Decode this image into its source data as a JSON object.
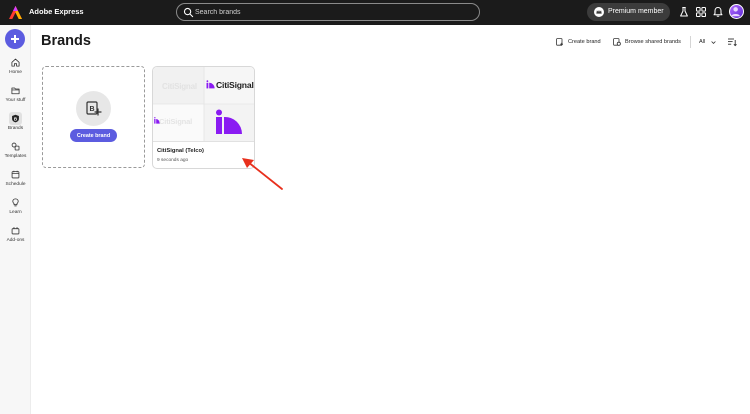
{
  "app": {
    "title": "Adobe Express"
  },
  "search": {
    "placeholder": "Search brands"
  },
  "premium": {
    "label": "Premium member"
  },
  "sidebar": {
    "items": [
      {
        "label": "Home",
        "icon": "home-icon"
      },
      {
        "label": "Your stuff",
        "icon": "folder-icon"
      },
      {
        "label": "Brands",
        "icon": "brands-icon",
        "active": true
      },
      {
        "label": "Templates",
        "icon": "templates-icon"
      },
      {
        "label": "Schedule",
        "icon": "calendar-icon"
      },
      {
        "label": "Learn",
        "icon": "lightbulb-icon"
      },
      {
        "label": "Add-ons",
        "icon": "addons-icon"
      }
    ]
  },
  "page": {
    "title": "Brands",
    "create_brand": "Create brand",
    "browse_shared": "Browse shared brands",
    "filter": "All"
  },
  "create_card": {
    "button": "Create brand"
  },
  "brand_card": {
    "name": "CitiSignal (Telco)",
    "updated": "9 seconds ago",
    "logo_text": "CitiSignal"
  },
  "colors": {
    "accent": "#5c5ce0",
    "brand_purple": "#8a1bf2",
    "annotation_arrow": "#e8301d"
  }
}
